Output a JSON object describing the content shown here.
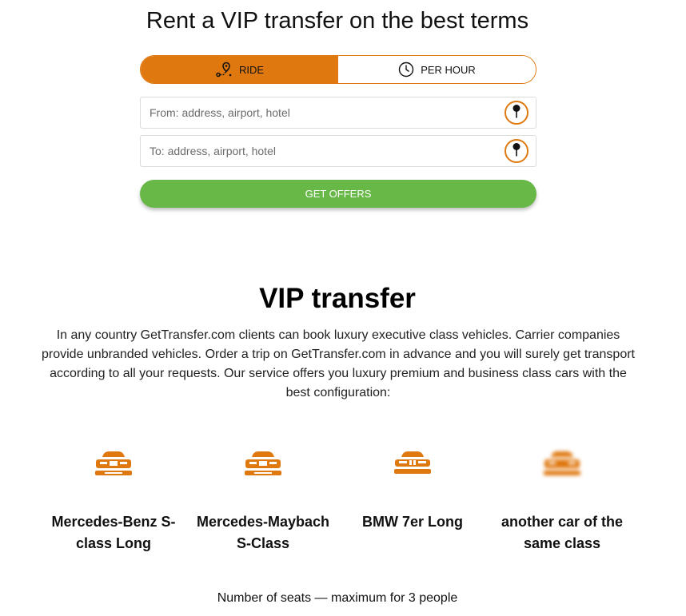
{
  "header": {
    "title": "Rent a VIP transfer on the best terms"
  },
  "mode_toggle": {
    "ride_label": "RIDE",
    "per_hour_label": "PER HOUR",
    "active": "RIDE"
  },
  "form": {
    "from_placeholder": "From: address, airport, hotel",
    "to_placeholder": "To: address, airport, hotel",
    "submit_label": "GET OFFERS"
  },
  "section": {
    "title": "VIP transfer",
    "description": "In any country GetTransfer.com clients can book luxury executive class vehicles. Carrier companies provide unbranded vehicles. Order a trip on GetTransfer.com in advance and you will surely get transport according to all your requests. Our service offers you luxury premium and business class cars with the best configuration:"
  },
  "cars": [
    {
      "name": "Mercedes-Benz S-class Long",
      "icon": "car-front-icon"
    },
    {
      "name": "Mercedes-Maybach S-Class",
      "icon": "car-front-icon"
    },
    {
      "name": "BMW 7er Long",
      "icon": "car-front-icon"
    },
    {
      "name": "another car of the same class",
      "icon": "car-front-icon"
    }
  ],
  "seats_note": "Number of seats — maximum for 3 people",
  "colors": {
    "accent": "#e07810",
    "button_green": "#67b847",
    "border": "#dcdcdc"
  }
}
